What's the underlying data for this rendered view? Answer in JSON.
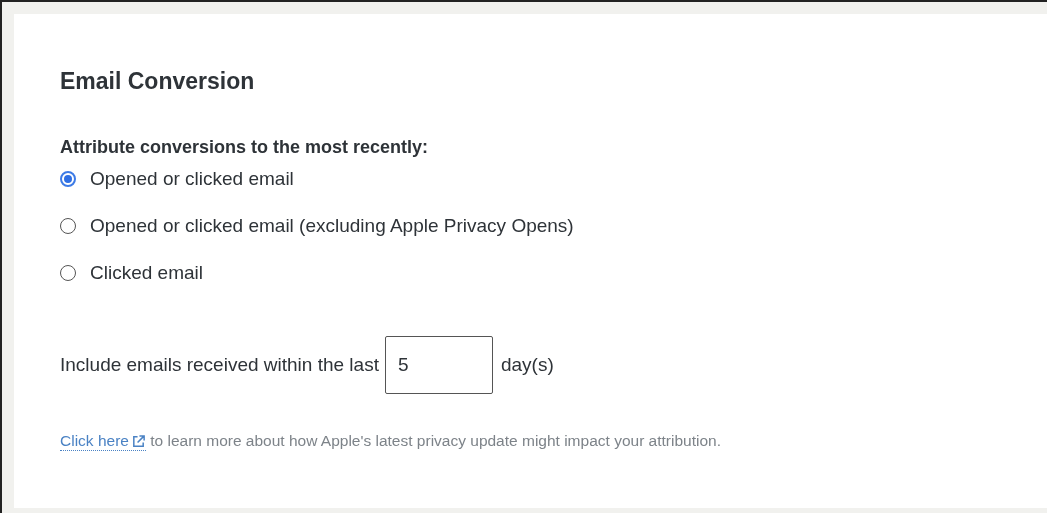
{
  "title": "Email Conversion",
  "attribution": {
    "label": "Attribute conversions to the most recently:",
    "options": [
      {
        "label": "Opened or clicked email",
        "selected": true
      },
      {
        "label": "Opened or clicked email (excluding Apple Privacy Opens)",
        "selected": false
      },
      {
        "label": "Clicked email",
        "selected": false
      }
    ]
  },
  "window_field": {
    "label": "Include emails received within the last",
    "value": "5",
    "unit": "day(s)"
  },
  "note": {
    "link": "Click here",
    "text": "to learn more about how Apple's latest privacy update might impact your attribution."
  }
}
